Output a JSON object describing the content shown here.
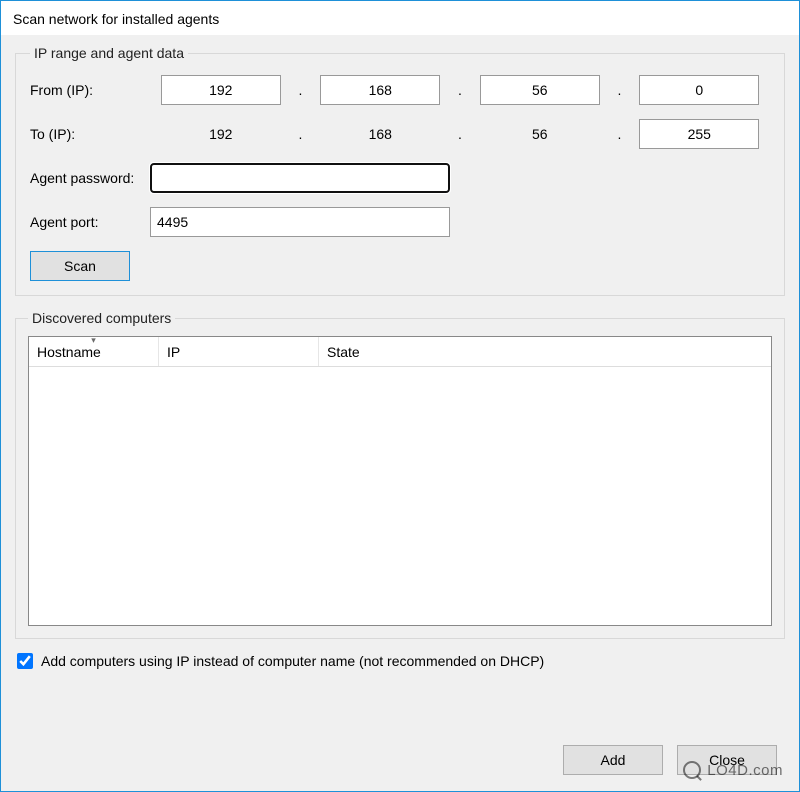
{
  "window": {
    "title": "Scan network for installed agents"
  },
  "ipGroup": {
    "legend": "IP range and agent data",
    "from_label": "From (IP):",
    "to_label": "To (IP):",
    "from": {
      "o1": "192",
      "o2": "168",
      "o3": "56",
      "o4": "0"
    },
    "to": {
      "o1": "192",
      "o2": "168",
      "o3": "56",
      "o4": "255"
    },
    "dot": ".",
    "password_label": "Agent password:",
    "password_value": "",
    "port_label": "Agent port:",
    "port_value": "4495",
    "scan_label": "Scan"
  },
  "discovered": {
    "legend": "Discovered computers",
    "col_hostname": "Hostname",
    "col_ip": "IP",
    "col_state": "State",
    "sort_col": "hostname"
  },
  "useIp": {
    "checked": true,
    "label": "Add computers using IP instead of computer name (not recommended on DHCP)"
  },
  "footer": {
    "add_label": "Add",
    "close_label": "Close"
  },
  "watermark": "LO4D.com"
}
